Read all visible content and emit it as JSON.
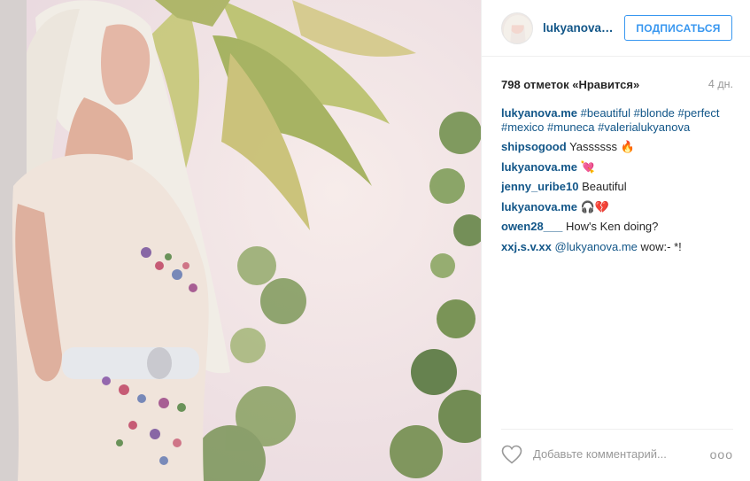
{
  "post": {
    "author": {
      "username": "lukyanova.me",
      "username_display": "lukyanova...."
    },
    "follow_label": "ПОДПИСАТЬСЯ",
    "likes_text": "798 отметок «Нравится»",
    "age_text": "4 дн.",
    "caption": {
      "user": "lukyanova.me",
      "tags": [
        "#beautiful",
        "#blonde",
        "#perfect",
        "#mexico",
        "#muneca",
        "#valerialukyanova"
      ]
    },
    "comments": [
      {
        "user": "shipsogood",
        "text": "Yassssss 🔥"
      },
      {
        "user": "lukyanova.me",
        "text": "💘"
      },
      {
        "user": "jenny_uribe10",
        "text": "Beautiful"
      },
      {
        "user": "lukyanova.me",
        "text": "🎧💔"
      },
      {
        "user": "owen28___",
        "text": "How's Ken doing?"
      },
      {
        "user": "xxj.s.v.xx",
        "mention": "@lukyanova.me",
        "text": "wow:- *!"
      }
    ],
    "comment_placeholder": "Добавьте комментарий...",
    "more_label": "ooo"
  },
  "colors": {
    "link": "#125688",
    "follow": "#3897f0",
    "muted": "#999999",
    "border": "#efefef"
  },
  "icons": {
    "like": "heart-outline-icon",
    "more": "more-options-icon"
  }
}
